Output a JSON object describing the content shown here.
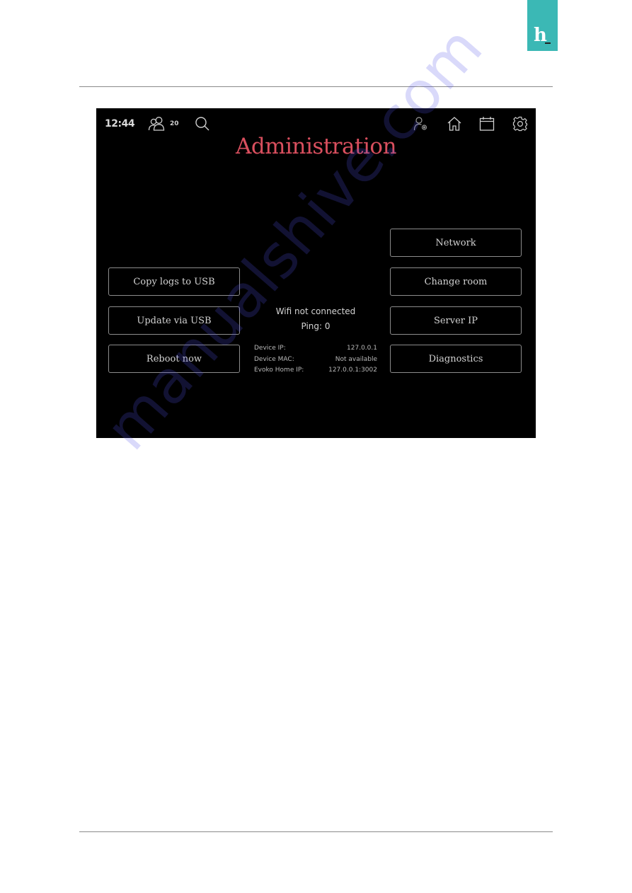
{
  "page": {
    "logo_glyph": "h",
    "watermark": "manualshive.com",
    "colors": {
      "logo_bg": "#3bb8b5",
      "title": "#d94f5e",
      "screen_bg": "#000000"
    }
  },
  "screen": {
    "topbar": {
      "time": "12:44",
      "people_count": "20",
      "icons": [
        "people-icon",
        "search-icon",
        "admin-user-icon",
        "home-icon",
        "calendar-icon",
        "settings-icon"
      ]
    },
    "title": "Administration",
    "left_buttons": [
      {
        "label": "Copy logs to USB"
      },
      {
        "label": "Update via USB"
      },
      {
        "label": "Reboot now"
      }
    ],
    "right_buttons": [
      {
        "label": "Network"
      },
      {
        "label": "Change room"
      },
      {
        "label": "Server IP"
      },
      {
        "label": "Diagnostics"
      }
    ],
    "status": {
      "wifi": "Wifi not connected",
      "ping": "Ping: 0"
    },
    "info": [
      {
        "label": "Device IP:",
        "value": "127.0.0.1"
      },
      {
        "label": "Device MAC:",
        "value": "Not available"
      },
      {
        "label": "Evoko Home IP:",
        "value": "127.0.0.1:3002"
      }
    ]
  }
}
